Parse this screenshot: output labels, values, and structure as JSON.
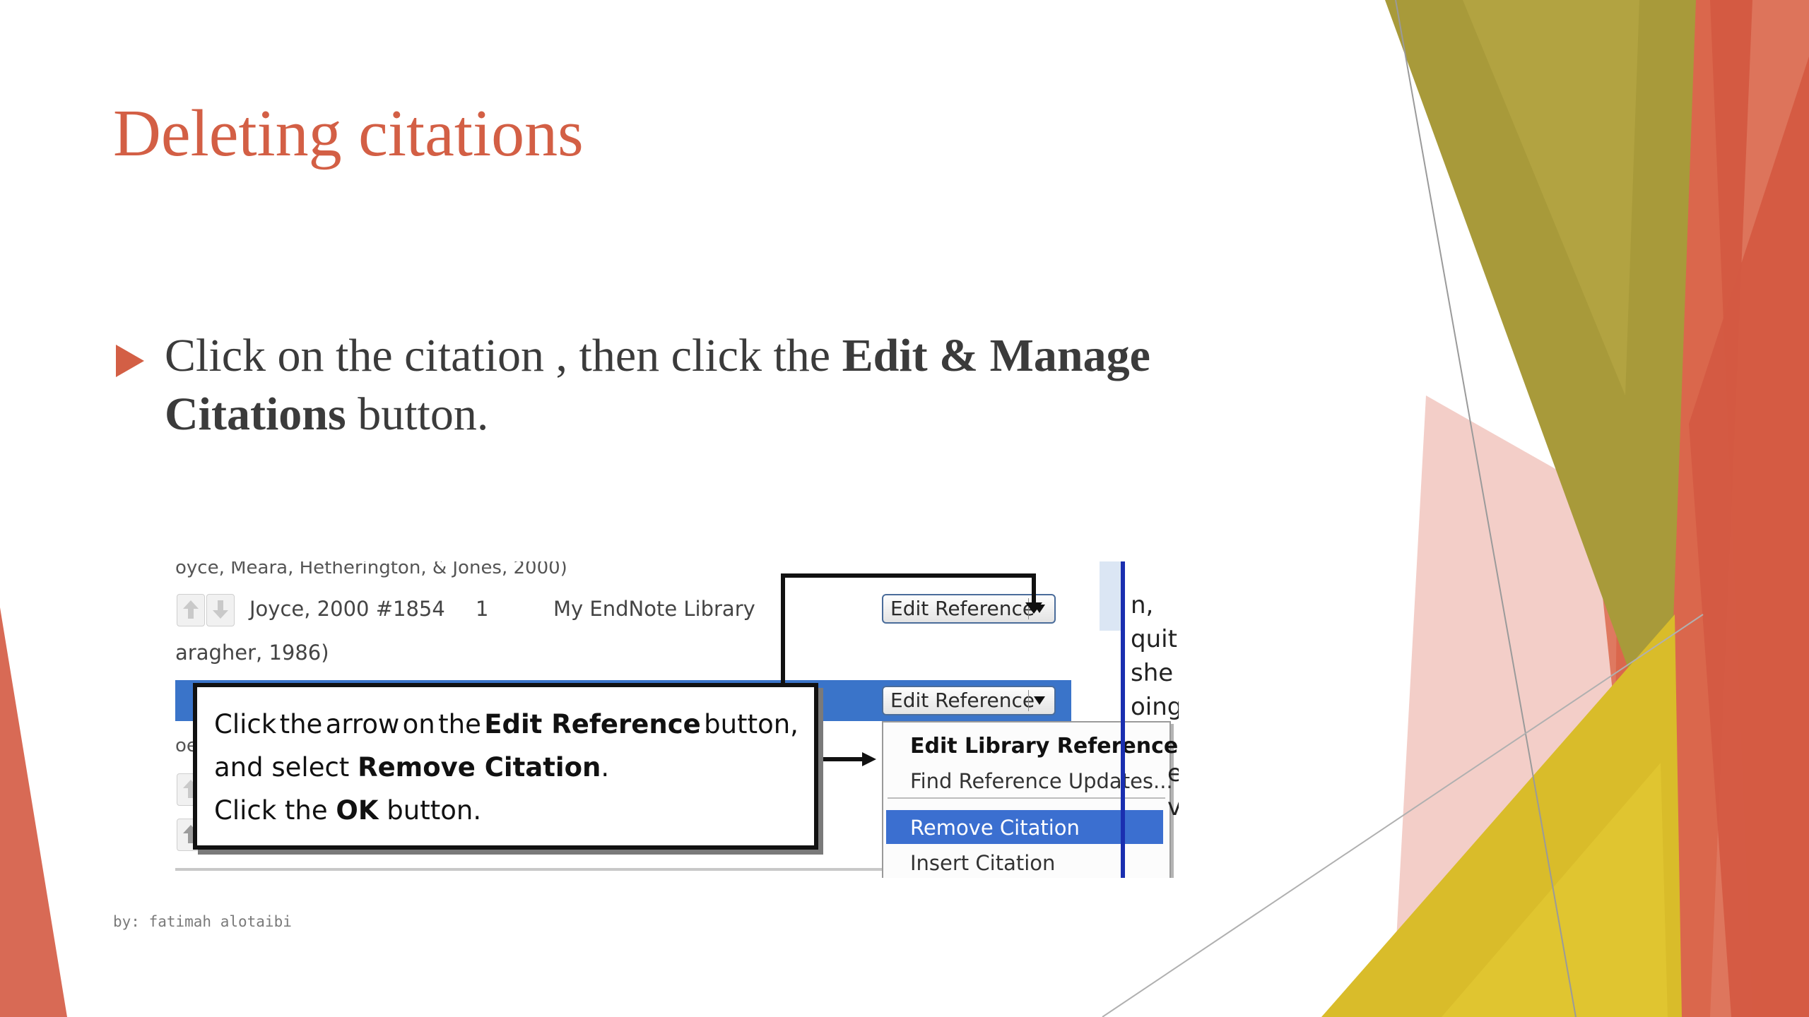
{
  "slide": {
    "title": "Deleting citations",
    "bullet": {
      "part1": "Click on the citation , then click the ",
      "bold1": "Edit & Manage Citations",
      "part2": " button."
    },
    "footer": "by: fatimah alotaibi",
    "colors": {
      "title": "#d35f45",
      "bullet_arrow": "#d35f45",
      "olive": "#a89a3a",
      "mustard": "#d9bc2a",
      "coral": "#d45a42",
      "pink": "#f1c5be"
    }
  },
  "screenshot": {
    "rows": {
      "top_cut": "oyce, Meara, Hetherington, & Jones, 2000)",
      "row1_ref": "Joyce, 2000 #1854",
      "row1_count": "1",
      "row1_library": "My EndNote Library",
      "row2_cut": "aragher, 1986)",
      "row3_cut": "oe"
    },
    "edit_button_label": "Edit Reference",
    "callout": {
      "l1_a": "Click",
      "l1_b": "the",
      "l1_c": "arrow",
      "l1_d": "on",
      "l1_e": "the",
      "l1_bold": "Edit Reference",
      "l1_f": "button,",
      "l2_a": "and select ",
      "l2_bold": "Remove Citation",
      "l2_b": ".",
      "l3_a": "Click the ",
      "l3_bold": "OK",
      "l3_b": " button."
    },
    "menu": {
      "items": [
        "Edit Library Reference",
        "Find Reference Updates...",
        "Remove Citation",
        "Insert Citation"
      ],
      "highlighted": "Remove Citation"
    },
    "right_cut_text": [
      "n,",
      "quit",
      "she",
      "oing",
      "e",
      "v"
    ]
  }
}
